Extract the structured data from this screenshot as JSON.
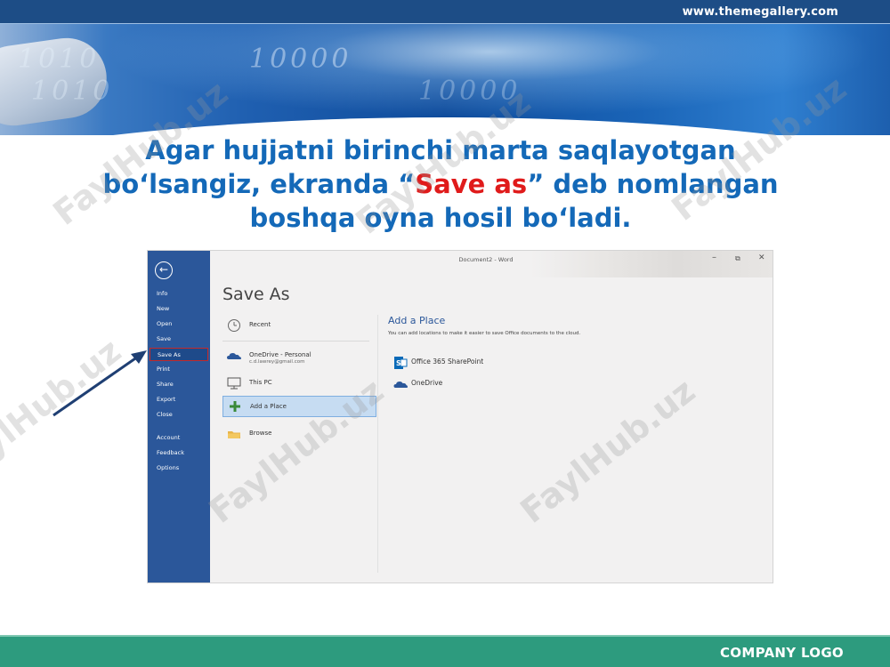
{
  "header": {
    "site_url": "www.themegallery.com",
    "banner_digits": [
      "1010",
      "1010",
      "10000",
      "10000"
    ]
  },
  "headline": {
    "line1": "Agar hujjatni birinchi marta saqlayotgan",
    "line2_before": "bo‘lsangiz, ekranda “",
    "line2_highlight": "Save as",
    "line2_after": "” deb nomlangan",
    "line3": "boshqa oyna hosil bo‘ladi.",
    "highlight_color": "#e01b1b",
    "text_color": "#1469b8"
  },
  "watermark": {
    "text": "FaylHub.uz"
  },
  "screenshot": {
    "window_title": "Document2 - Word",
    "window_controls": [
      "–",
      "⧉",
      "✕"
    ],
    "backstage_title": "Save As",
    "sidebar_color": "#2b579a",
    "sidebar": {
      "items": [
        "Info",
        "New",
        "Open",
        "Save",
        "Save As",
        "Print",
        "Share",
        "Export",
        "Close",
        "Account",
        "Feedback",
        "Options"
      ],
      "active": "Save As"
    },
    "places": [
      {
        "label": "Recent",
        "sub": "",
        "icon": "clock-icon"
      },
      {
        "label": "OneDrive - Personal",
        "sub": "c.d.lawrey@gmail.com",
        "icon": "onedrive-cloud-icon"
      },
      {
        "label": "This PC",
        "sub": "",
        "icon": "pc-monitor-icon"
      },
      {
        "label": "Add a Place",
        "sub": "",
        "icon": "plus-icon",
        "selected": true
      },
      {
        "label": "Browse",
        "sub": "",
        "icon": "folder-icon"
      }
    ],
    "add_place_panel": {
      "title": "Add a Place",
      "description": "You can add locations to make it easier to save Office documents to the cloud.",
      "options": [
        {
          "label": "Office 365 SharePoint",
          "icon": "sharepoint-icon"
        },
        {
          "label": "OneDrive",
          "icon": "onedrive-cloud-icon"
        }
      ]
    }
  },
  "footer": {
    "company_logo": "COMPANY LOGO"
  }
}
